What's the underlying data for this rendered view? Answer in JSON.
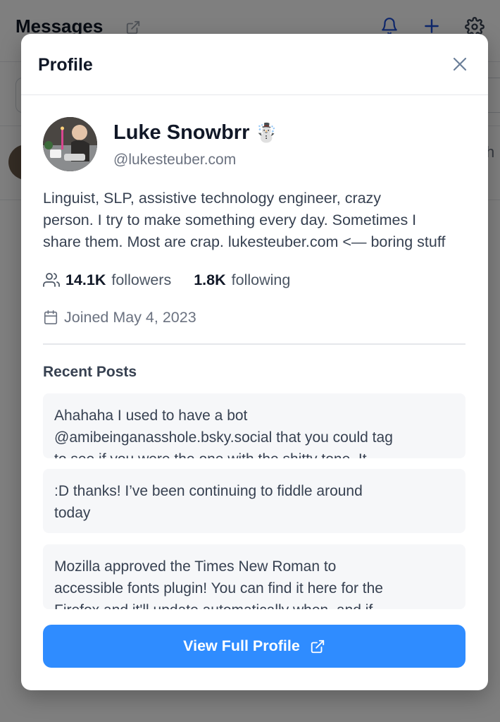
{
  "background": {
    "title": "Messages",
    "side_text": "h"
  },
  "modal": {
    "title": "Profile",
    "close_icon": "close-icon"
  },
  "profile": {
    "display_name": "Luke Snowbrr",
    "name_emoji": "☃️",
    "handle": "@lukesteuber.com",
    "bio_lines": [
      "Linguist, SLP, assistive technology engineer, crazy",
      "person. I try to make something every day. Sometimes I",
      "share them. Most are crap. lukesteuber.com <— boring stuff"
    ],
    "followers_count": "14.1K",
    "followers_label": "followers",
    "following_count": "1.8K",
    "following_label": "following",
    "joined": "Joined May 4, 2023"
  },
  "recent_posts": {
    "heading": "Recent Posts",
    "posts": [
      {
        "line1": "Ahahaha I used to have a bot",
        "line2": "@amibeinganasshole.bsky.social that you could tag",
        "line3": "to see if you were the one with the shitty tone. It"
      },
      {
        "line1": ":D thanks! I’ve been continuing to fiddle around",
        "line2": "today"
      },
      {
        "line1": "Mozilla approved the Times New Roman to",
        "line2": "accessible fonts plugin! You can find it here for the",
        "line3": "Firefox and it'll update automatically when, and if"
      }
    ]
  },
  "actions": {
    "view_full_profile": "View Full Profile"
  },
  "colors": {
    "primary_button": "#2f8cff",
    "overlay": "rgba(0,0,0,0.5)"
  }
}
